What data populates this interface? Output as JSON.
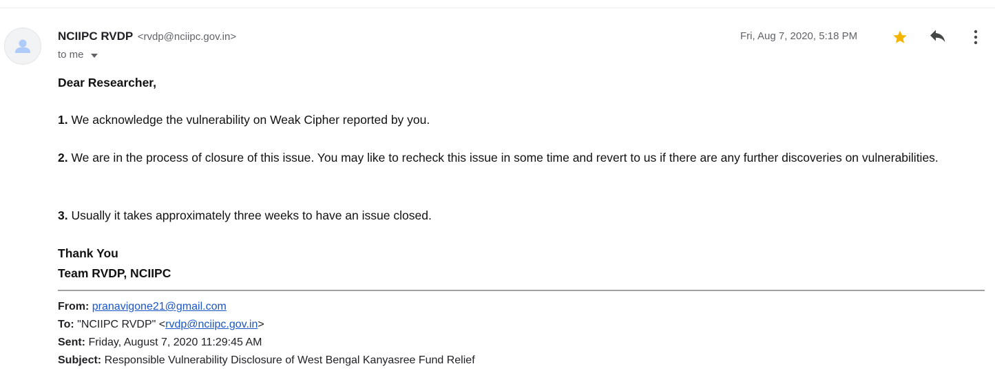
{
  "message": {
    "sender_name": "NCIIPC RVDP",
    "sender_email": "<rvdp@nciipc.gov.in>",
    "to_label": "to me",
    "date": "Fri, Aug 7, 2020, 5:18 PM"
  },
  "icons": {
    "avatar": "person-avatar-icon",
    "star": "star-icon",
    "reply": "reply-icon",
    "more": "more-vertical-icon",
    "to_dropdown": "chevron-down-icon"
  },
  "colors": {
    "star": "#f4b400",
    "link": "#1a55c9",
    "secondary_text": "#5f6368",
    "avatar_figure": "#aecbfa"
  },
  "body": {
    "greeting": "Dear Researcher,",
    "items": [
      {
        "number": "1.",
        "text": "We acknowledge the vulnerability on Weak Cipher reported by you."
      },
      {
        "number": "2.",
        "text": "We are in the process of closure of this issue. You may like to recheck this issue in some time and revert to us if there are any further discoveries on vulnerabilities."
      },
      {
        "number": "3.",
        "text": "Usually it takes approximately three weeks to have an issue closed."
      }
    ],
    "signature_line1": "Thank You",
    "signature_line2": "Team RVDP, NCIIPC"
  },
  "quoted": {
    "from_label": "From:",
    "from_value": "pranavigone21@gmail.com",
    "to_label": "To:",
    "to_prefix": "\"NCIIPC RVDP\" <",
    "to_email": "rvdp@nciipc.gov.in",
    "to_suffix": ">",
    "sent_label": "Sent:",
    "sent_value": "Friday, August 7, 2020 11:29:45 AM",
    "subject_label": "Subject:",
    "subject_value": "Responsible Vulnerability Disclosure of West Bengal Kanyasree Fund Relief"
  }
}
